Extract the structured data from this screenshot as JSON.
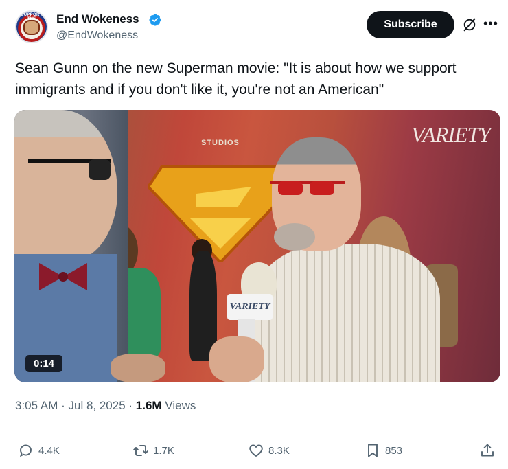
{
  "author": {
    "display_name": "End Wokeness",
    "handle": "@EndWokeness",
    "avatar_text": "SUPPORT THE"
  },
  "header": {
    "subscribe_label": "Subscribe",
    "grok_icon": "grok-icon",
    "more_icon": "more-icon"
  },
  "tweet": {
    "text": "Sean Gunn on the new Superman movie: \"It is about how we support immigrants and if you don't like it, you're not an American\""
  },
  "media": {
    "duration": "0:14",
    "studios_text": "STUDIOS",
    "variety_logo": "VARIETY",
    "mic_flag": "VARIETY"
  },
  "meta": {
    "time": "3:05 AM",
    "sep1": " · ",
    "date": "Jul 8, 2025",
    "sep2": " · ",
    "views_count": "1.6M",
    "views_label": " Views"
  },
  "actions": {
    "replies": "4.4K",
    "reposts": "1.7K",
    "likes": "8.3K",
    "bookmarks": "853"
  },
  "colors": {
    "verified": "#1d9bf0",
    "text_primary": "#0f1419",
    "text_secondary": "#536471",
    "button_bg": "#0f1419"
  }
}
